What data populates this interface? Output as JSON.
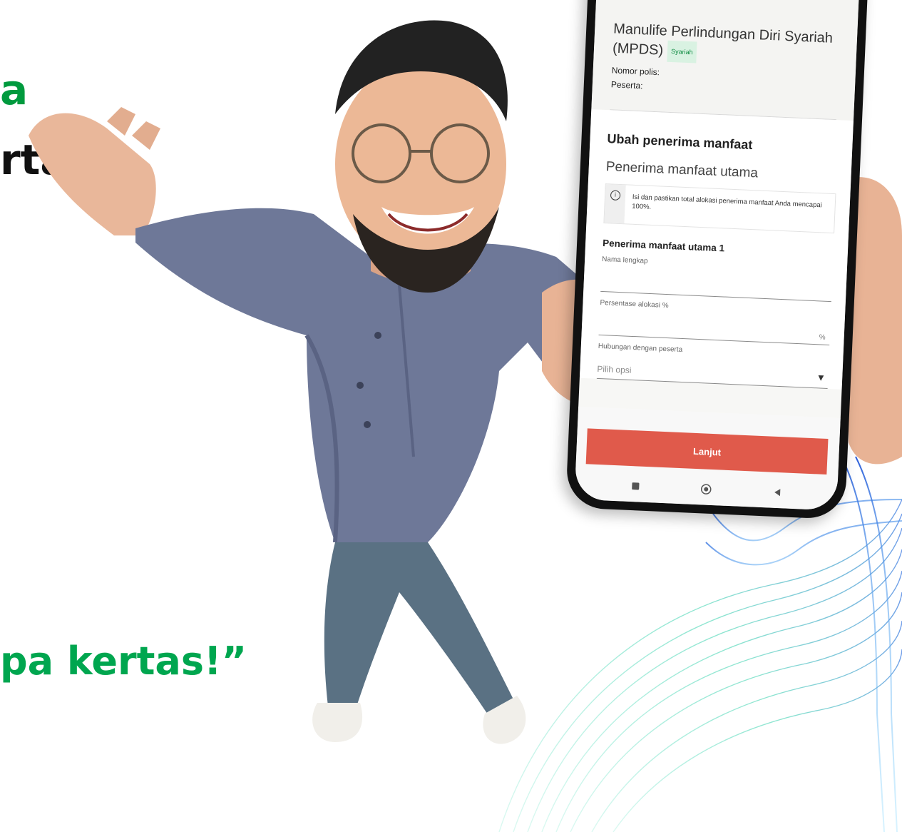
{
  "headline": {
    "line1_fragment": "a",
    "line2_fragment": "rtal",
    "quote_fragment": "pa kertas!”"
  },
  "phone": {
    "product_name": "Manulife Perlindungan Diri Syariah (MPDS)",
    "badge": "Syariah",
    "policy_number_label": "Nomor polis:",
    "participant_label": "Peserta:",
    "section_title": "Ubah penerima manfaat",
    "subsection_title": "Penerima manfaat utama",
    "info_message": "Isi dan pastikan total alokasi penerima manfaat Anda mencapai 100%.",
    "beneficiary_title": "Penerima manfaat utama 1",
    "fields": {
      "full_name_label": "Nama lengkap",
      "allocation_label": "Persentase alokasi %",
      "allocation_suffix": "%",
      "relationship_label": "Hubungan dengan peserta",
      "relationship_placeholder": "Pilih opsi"
    },
    "next_button": "Lanjut"
  },
  "colors": {
    "brand_green": "#00a64f",
    "button_red": "#e05a4b",
    "badge_bg": "#d9f2e2"
  },
  "icons": {
    "info": "info-icon",
    "select_chevron": "chevron-down-icon",
    "nav_recent": "square-icon",
    "nav_home": "circle-icon",
    "nav_back": "triangle-back-icon"
  }
}
